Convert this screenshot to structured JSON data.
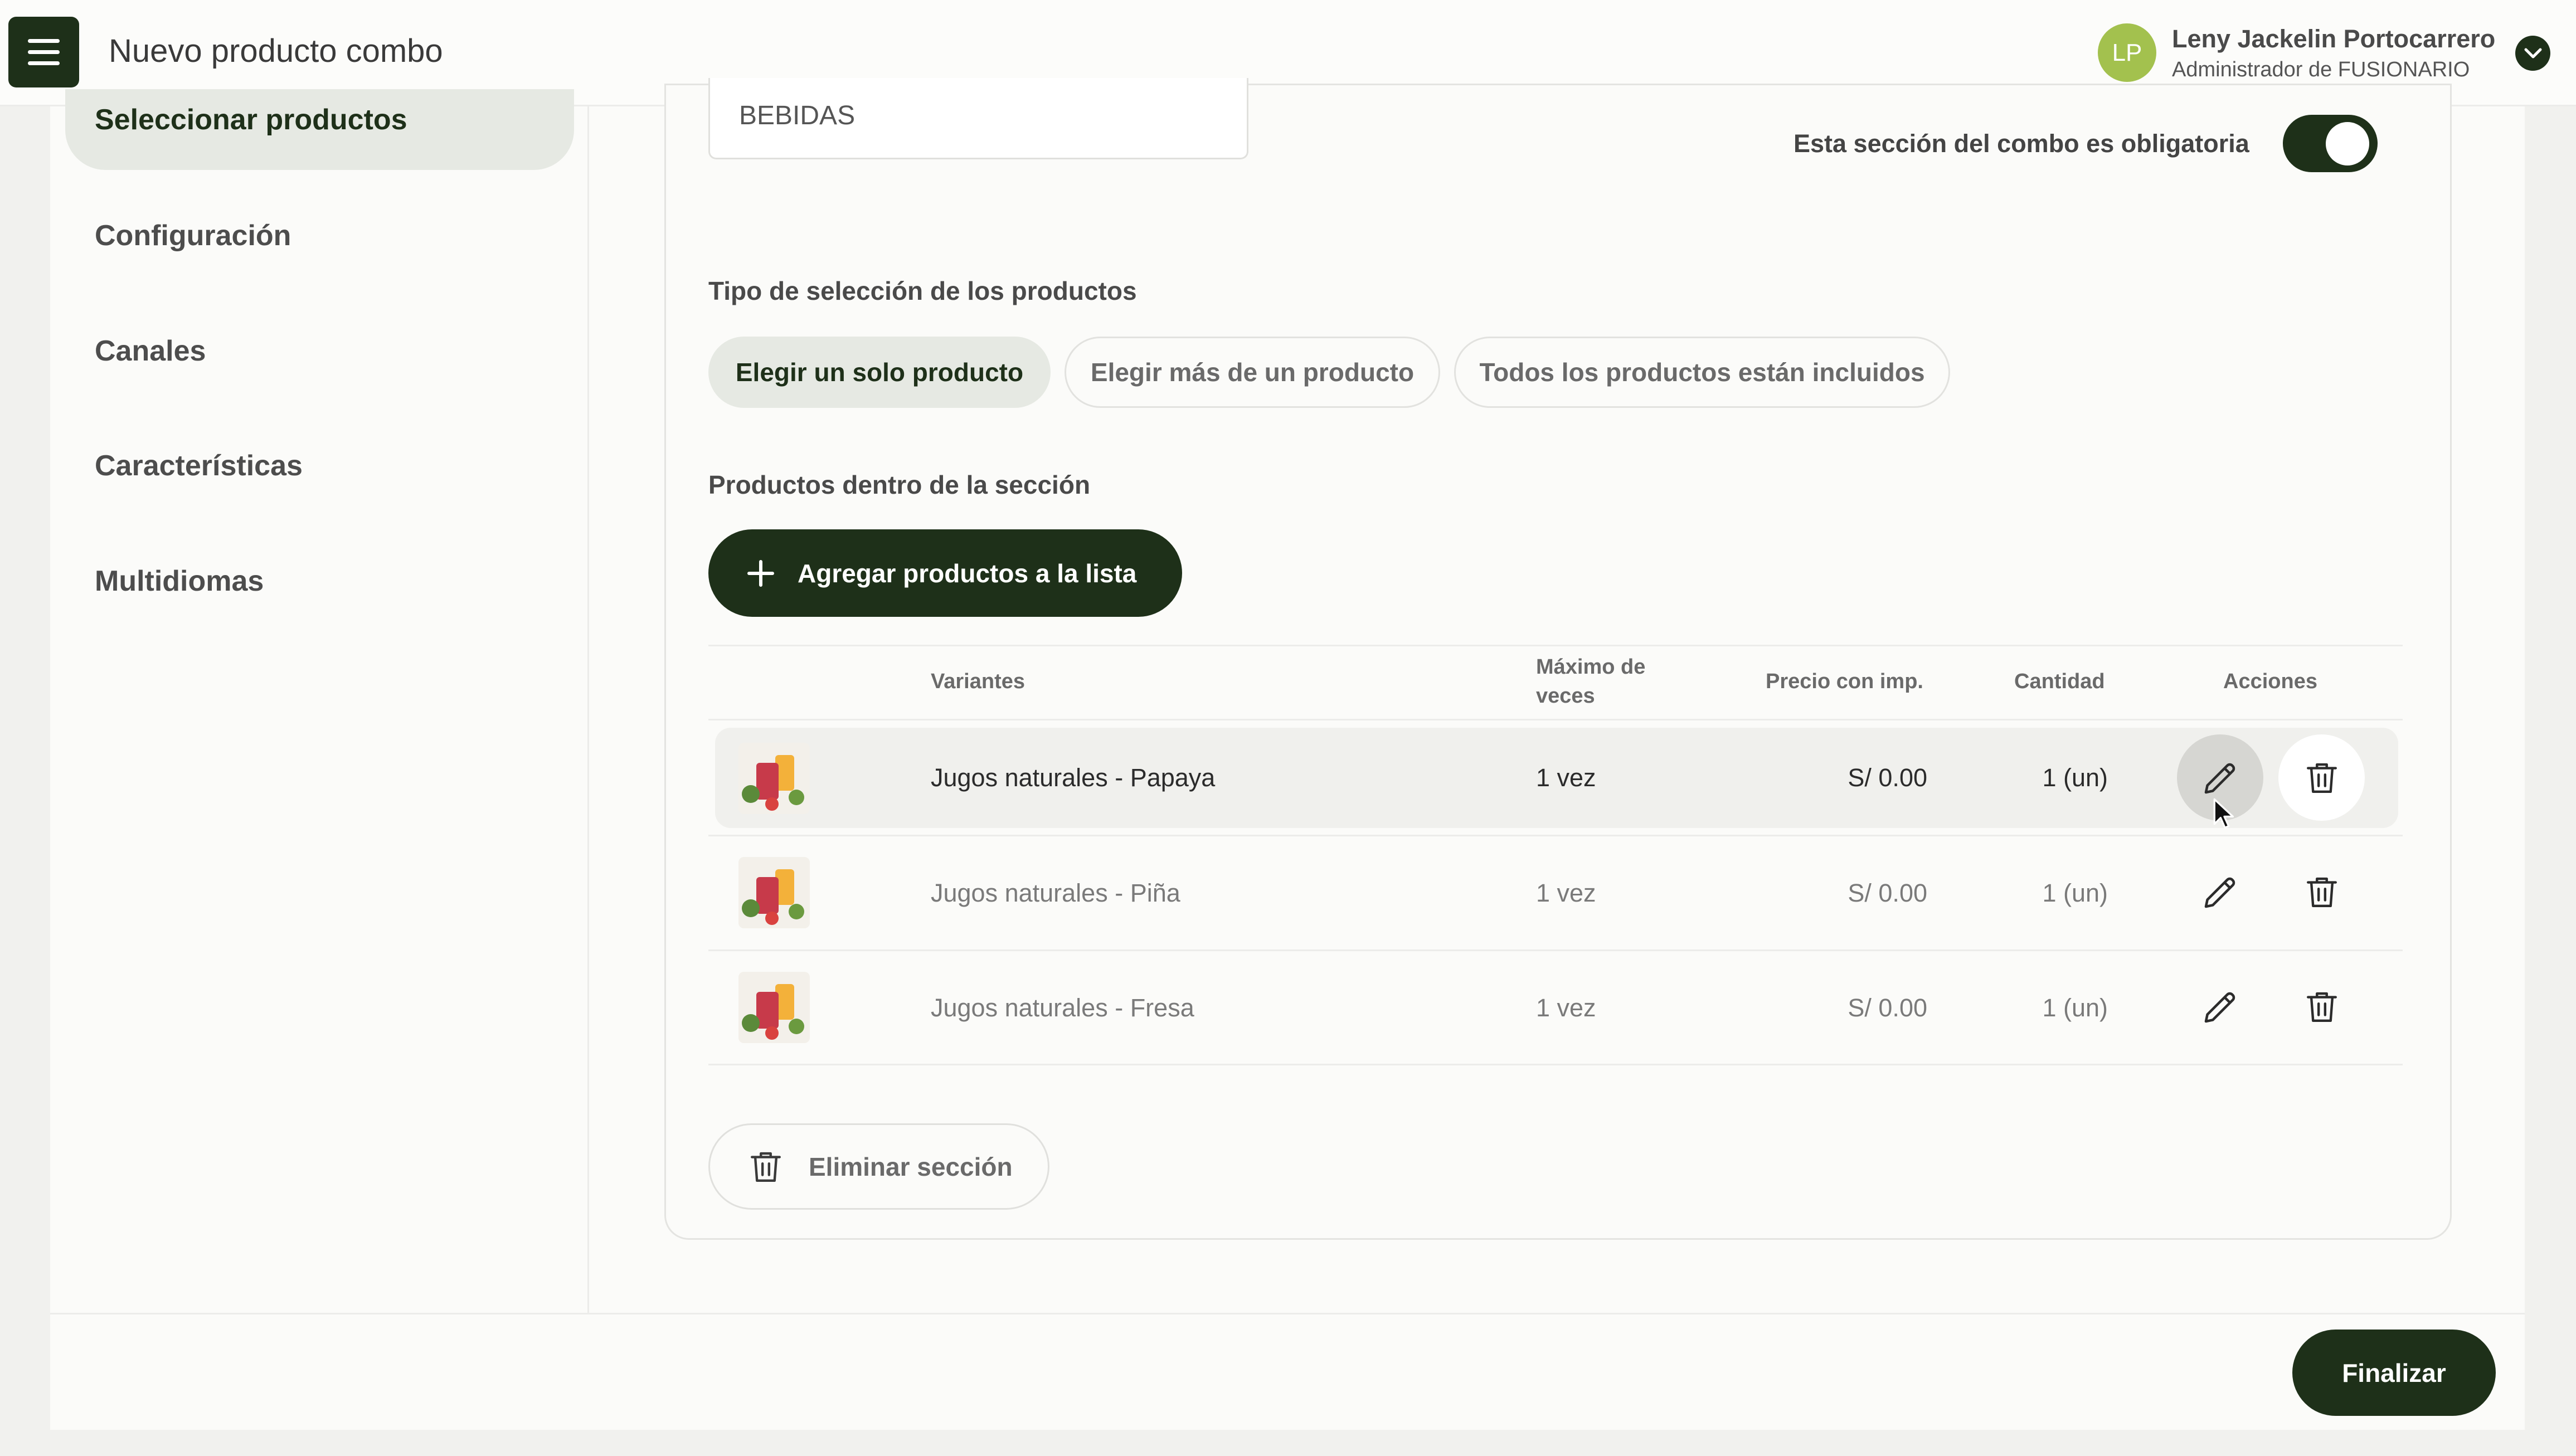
{
  "header": {
    "title": "Nuevo producto combo",
    "user": {
      "initials": "LP",
      "name": "Leny Jackelin Portocarrero",
      "role": "Administrador de FUSIONARIO"
    }
  },
  "sidebar": {
    "items": [
      {
        "label": "Seleccionar productos",
        "active": true
      },
      {
        "label": "Configuración",
        "active": false
      },
      {
        "label": "Canales",
        "active": false
      },
      {
        "label": "Características",
        "active": false
      },
      {
        "label": "Multidiomas",
        "active": false
      }
    ]
  },
  "section": {
    "name_value": "BEBIDAS",
    "required_label": "Esta sección del combo es obligatoria",
    "required_on": true,
    "selection_type_label": "Tipo de selección de los productos",
    "selection_options": [
      {
        "label": "Elegir un solo producto",
        "active": true
      },
      {
        "label": "Elegir más de un producto",
        "active": false
      },
      {
        "label": "Todos los productos están incluidos",
        "active": false
      }
    ],
    "products_label": "Productos dentro de la sección",
    "add_button": "Agregar productos a la lista",
    "delete_section_button": "Eliminar sección"
  },
  "table": {
    "headers": {
      "variants": "Variantes",
      "max_times": "Máximo de veces",
      "price": "Precio con imp.",
      "quantity": "Cantidad",
      "actions": "Acciones"
    },
    "rows": [
      {
        "variant": "Jugos naturales - Papaya",
        "max_times": "1 vez",
        "price": "S/ 0.00",
        "quantity": "1 (un)"
      },
      {
        "variant": "Jugos naturales - Piña",
        "max_times": "1 vez",
        "price": "S/ 0.00",
        "quantity": "1 (un)"
      },
      {
        "variant": "Jugos naturales - Fresa",
        "max_times": "1 vez",
        "price": "S/ 0.00",
        "quantity": "1 (un)"
      }
    ]
  },
  "footer": {
    "finalize_button": "Finalizar"
  },
  "colors": {
    "brand_dark": "#1e3019",
    "active_bg": "#e6e9e3",
    "avatar": "#a3c14e"
  }
}
